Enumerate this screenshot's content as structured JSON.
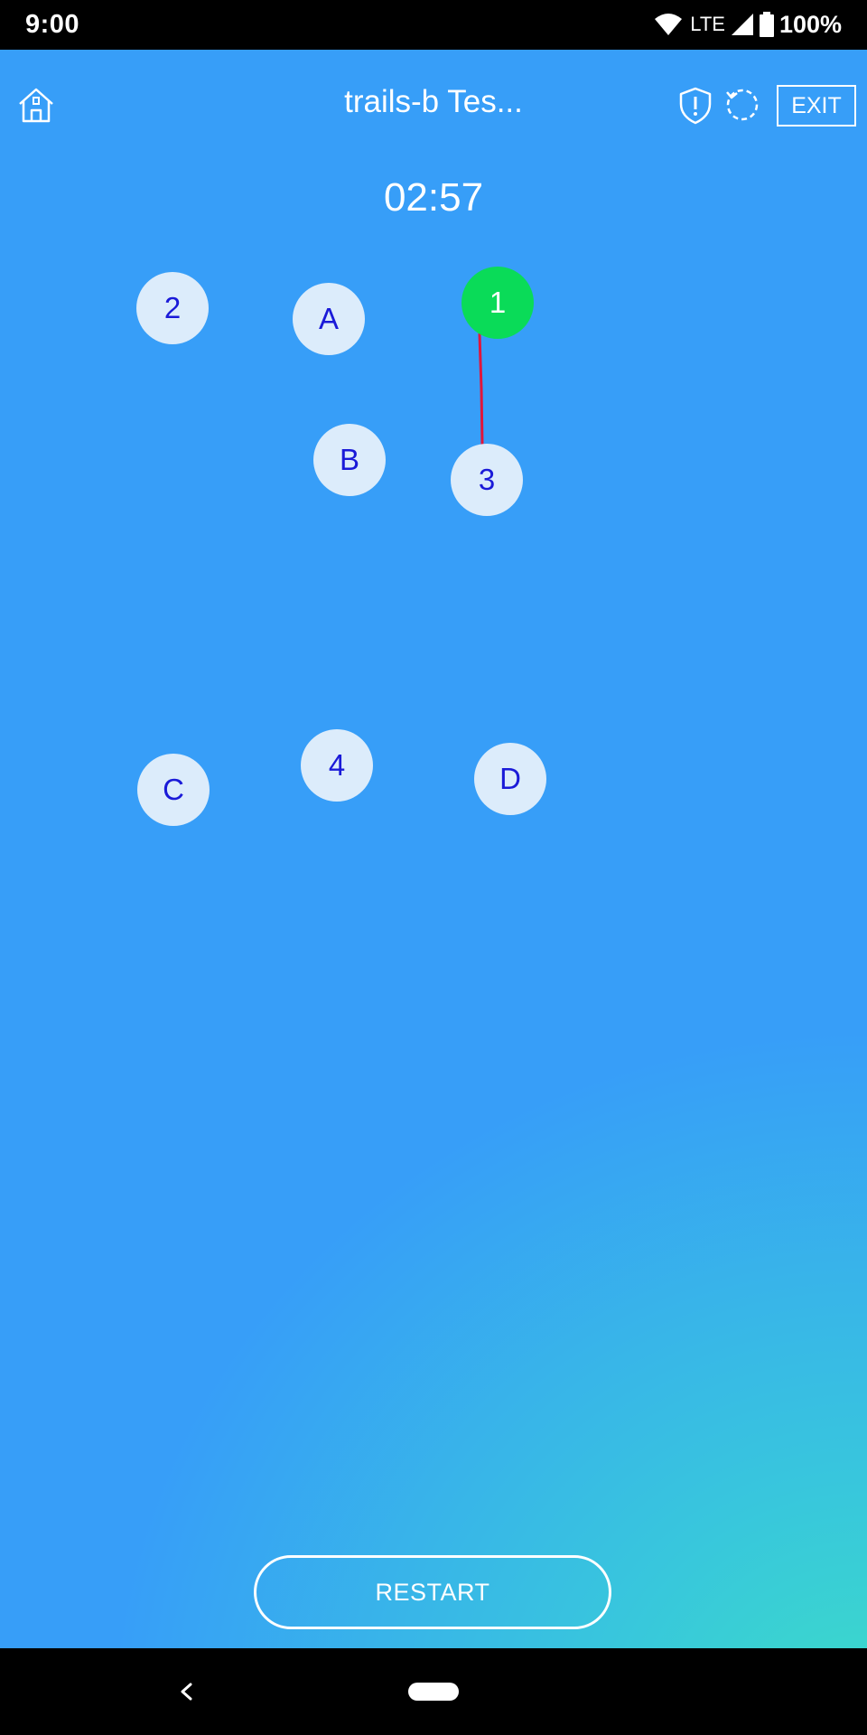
{
  "status_bar": {
    "time": "9:00",
    "network": "LTE",
    "battery": "100%",
    "icons": [
      "wifi-icon",
      "cell-signal-icon",
      "battery-icon"
    ]
  },
  "header": {
    "title": "trails-b Tes...",
    "exit_label": "EXIT",
    "icons": [
      "home-icon",
      "shield-alert-icon",
      "reset-icon"
    ]
  },
  "timer": "02:57",
  "trail": {
    "nodes": [
      {
        "label": "1",
        "state": "done"
      },
      {
        "label": "2",
        "state": "pending"
      },
      {
        "label": "A",
        "state": "pending"
      },
      {
        "label": "B",
        "state": "pending"
      },
      {
        "label": "3",
        "state": "pending"
      },
      {
        "label": "4",
        "state": "pending"
      },
      {
        "label": "C",
        "state": "pending"
      },
      {
        "label": "D",
        "state": "pending"
      }
    ],
    "connection_color": "#e0163c",
    "done_color": "#0adb58"
  },
  "restart_label": "RESTART",
  "nav": {
    "icons": [
      "back-icon",
      "home-pill"
    ]
  }
}
